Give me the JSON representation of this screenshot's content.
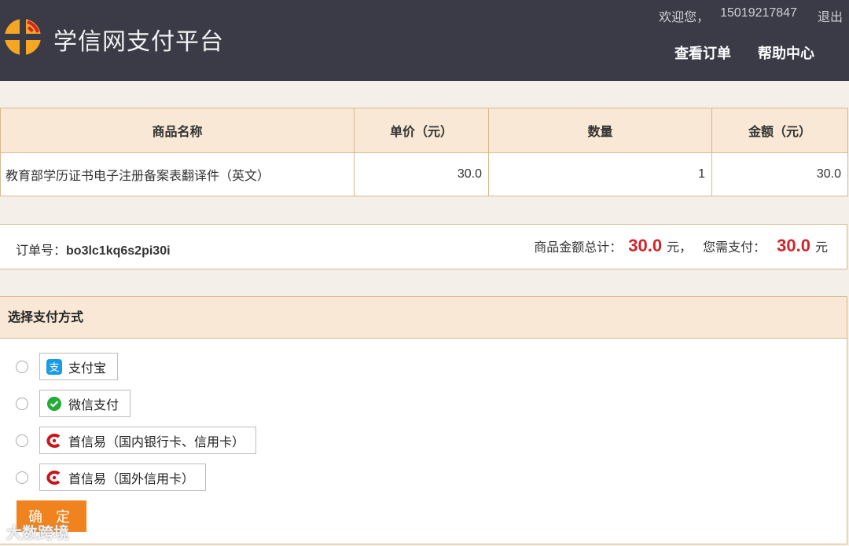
{
  "header": {
    "brand": "学信网支付平台",
    "welcome": "欢迎您，",
    "user": "15019217847",
    "logout": "退出",
    "nav": [
      "查看订单",
      "帮助中心"
    ]
  },
  "product_table": {
    "headers": [
      "商品名称",
      "单价（元）",
      "数量",
      "金额（元）"
    ],
    "row": {
      "name": "教育部学历证书电子注册备案表翻译件（英文）",
      "unit_price": "30.0",
      "quantity": "1",
      "amount": "30.0"
    }
  },
  "order": {
    "label": "订单号：",
    "number": "bo3lc1kq6s2pi30i",
    "total_label": "商品金额总计：",
    "total": "30.0",
    "unit": "元，",
    "pay_label": "您需支付：",
    "pay": "30.0",
    "pay_unit": "元"
  },
  "payment": {
    "title": "选择支付方式",
    "options": [
      "支付宝",
      "微信支付",
      "首信易（国内银行卡、信用卡）",
      "首信易（国外信用卡）"
    ],
    "confirm": "确 定"
  },
  "watermark": "大数跨境",
  "colors": {
    "header_bg": "#3a3b47",
    "accent": "#f0831d",
    "price": "#d0242b",
    "table_header_bg": "#f8e8d5"
  }
}
